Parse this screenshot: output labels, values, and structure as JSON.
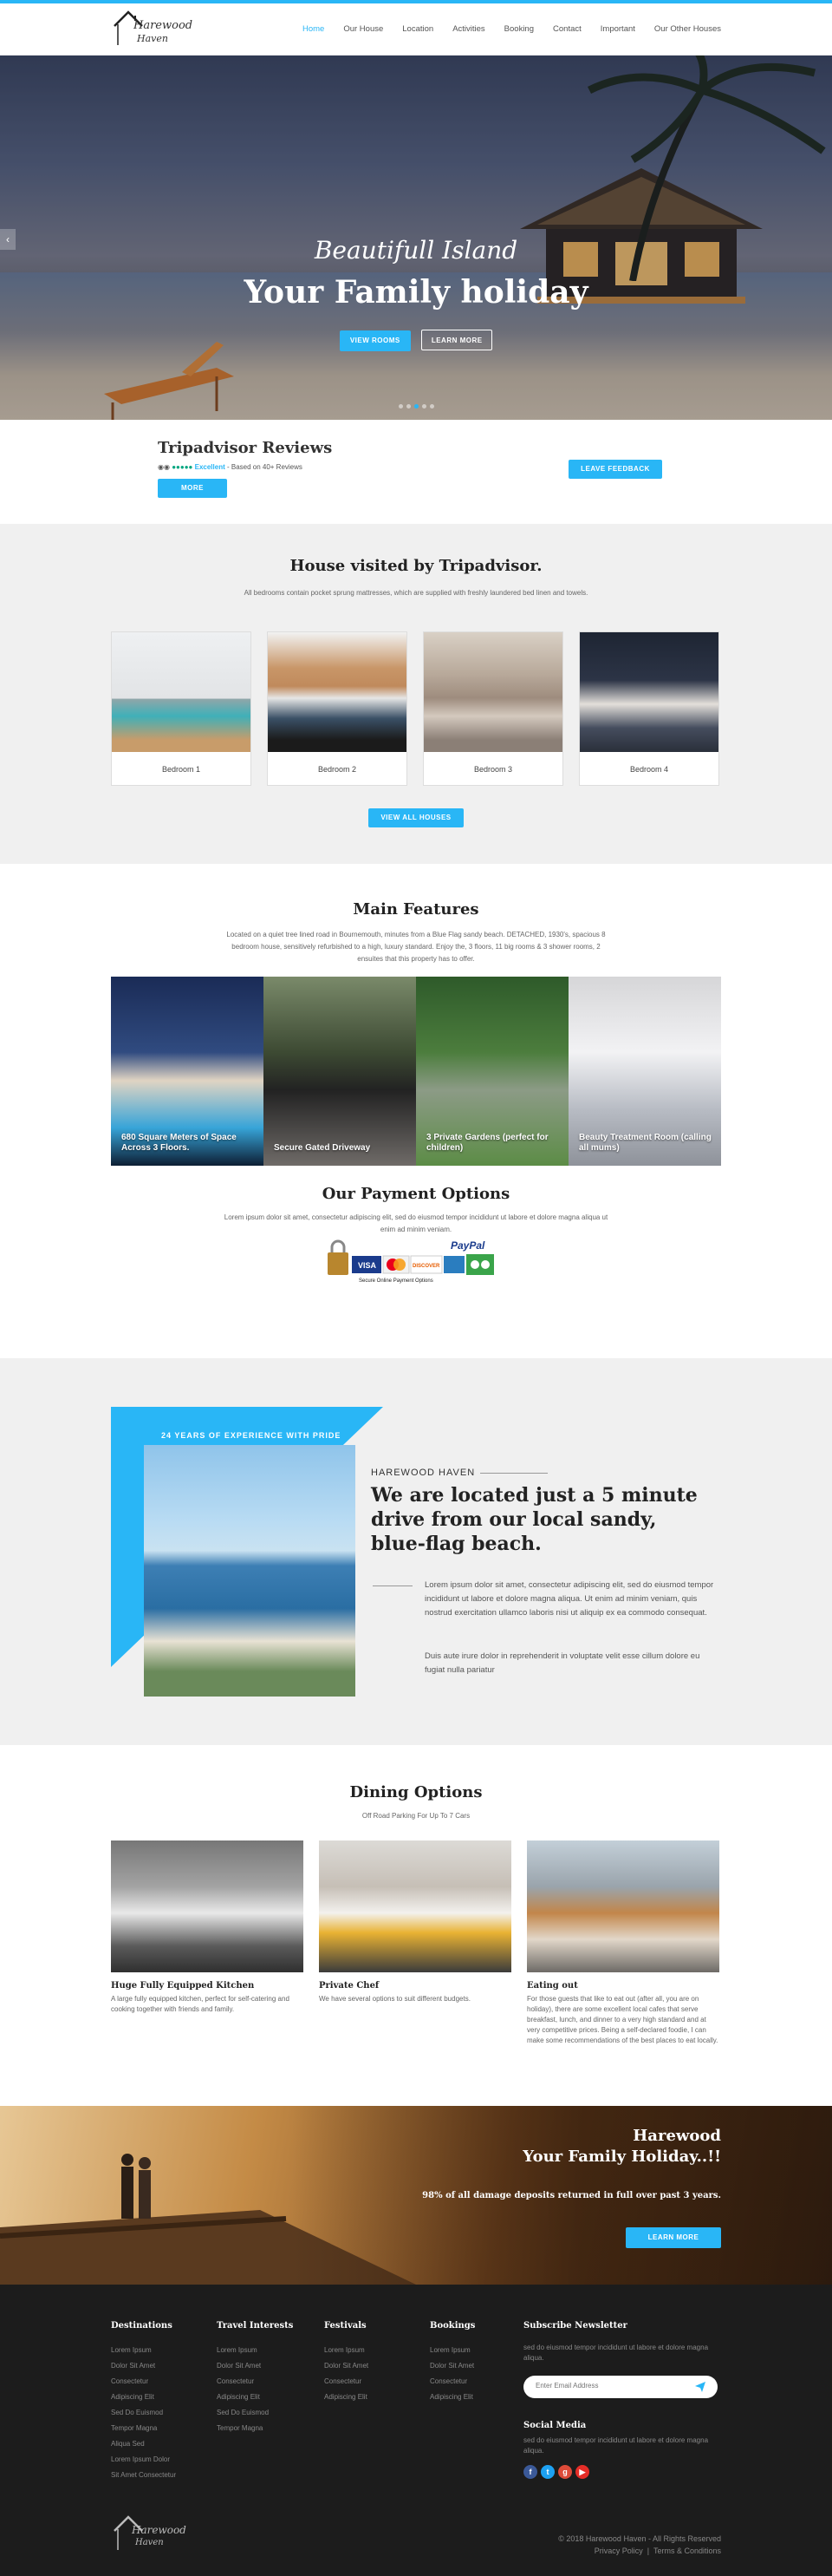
{
  "brand": {
    "logo_line1": "Harewood",
    "logo_line2": "Haven",
    "accent": "#29b6f6"
  },
  "nav": {
    "items": [
      "Home",
      "Our House",
      "Location",
      "Activities",
      "Booking",
      "Contact",
      "Important",
      "Our Other Houses"
    ],
    "active": "Home"
  },
  "hero": {
    "subtitle": "Beautifull Island",
    "title": "Your Family holiday",
    "btn_primary": "VIEW ROOMS",
    "btn_secondary": "LEARN MORE",
    "slide_count": 5,
    "active_slide": 3
  },
  "tripadvisor": {
    "title": "Tripadvisor Reviews",
    "rating_label": "Excellent",
    "rating_text": " - Based on 40+ Reviews",
    "more": "MORE",
    "feedback": "LEAVE FEEDBACK"
  },
  "rooms": {
    "title": "House visited by Tripadvisor.",
    "text": "All bedrooms contain pocket sprung mattresses, which are supplied with freshly laundered bed linen and towels.",
    "items": [
      "Bedroom 1",
      "Bedroom 2",
      "Bedroom 3",
      "Bedroom 4"
    ],
    "view_all": "VIEW ALL HOUSES"
  },
  "features": {
    "title": "Main Features",
    "text": "Located on a quiet tree lined road in Bournemouth, minutes from a Blue Flag sandy beach. DETACHED, 1930's, spacious 8 bedroom house, sensitively refurbished to a high, luxury standard. Enjoy the, 3 floors, 11 big rooms & 3 shower rooms, 2 ensuites that this property has to offer.",
    "items": [
      "680 Square Meters of Space Across 3 Floors.",
      "Secure Gated Driveway",
      "3 Private Gardens (perfect for children)",
      "Beauty Treatment Room (calling all mums)"
    ]
  },
  "payment": {
    "title": "Our Payment Options",
    "text": "Lorem ipsum dolor sit amet, consectetur adipiscing elit, sed do eiusmod tempor incididunt ut labore et dolore magna aliqua ut enim ad minim veniam.",
    "logo_paypal": "PayPal",
    "logo_visa": "VISA",
    "logo_discover": "DISCOVER",
    "logo_caption": "Secure Online Payment Options"
  },
  "location": {
    "badge": "24 YEARS OF EXPERIENCE WITH PRIDE",
    "eyebrow": "HAREWOOD HAVEN",
    "title": "We are located just a 5 minute drive from our local sandy, blue-flag beach.",
    "p1": "Lorem ipsum dolor sit amet, consectetur adipiscing elit, sed do eiusmod tempor incididunt ut labore et dolore magna aliqua. Ut enim ad minim veniam, quis nostrud exercitation ullamco laboris nisi ut aliquip ex ea commodo consequat.",
    "p2": "Duis aute irure dolor in reprehenderit in voluptate velit esse cillum dolore eu fugiat nulla pariatur"
  },
  "dining": {
    "title": "Dining Options",
    "subtitle": "Off Road Parking For Up To 7 Cars",
    "items": [
      {
        "title": "Huge Fully Equipped Kitchen",
        "text": "A large fully equipped kitchen, perfect for self-catering and cooking together with friends and family."
      },
      {
        "title": "Private Chef",
        "text": "We have several options to suit different budgets."
      },
      {
        "title": "Eating out",
        "text": "For those guests that like to eat out (after all, you are on holiday), there are some excellent local cafes that serve breakfast, lunch, and dinner to a very high standard and at very competitive prices. Being a self-declared foodie, I can make some recommendations of the best places to eat locally."
      }
    ]
  },
  "banner": {
    "line1": "Harewood",
    "line2": "Your Family Holiday..!!",
    "line3": "98% of all damage deposits returned in full over past 3 years.",
    "button": "LEARN MORE"
  },
  "footer": {
    "columns": [
      {
        "title": "Destinations",
        "items": [
          "Lorem Ipsum",
          "Dolor Sit Amet",
          "Consectetur",
          "Adipiscing Elit",
          "Sed Do Euismod",
          "Tempor Magna",
          "Aliqua Sed",
          "Lorem Ipsum Dolor",
          "Sit Amet Consectetur"
        ]
      },
      {
        "title": "Travel Interests",
        "items": [
          "Lorem Ipsum",
          "Dolor Sit Amet",
          "Consectetur",
          "Adipiscing Elit",
          "Sed Do Euismod",
          "Tempor Magna"
        ]
      },
      {
        "title": "Festivals",
        "items": [
          "Lorem Ipsum",
          "Dolor Sit Amet",
          "Consectetur",
          "Adipiscing Elit"
        ]
      },
      {
        "title": "Bookings",
        "items": [
          "Lorem Ipsum",
          "Dolor Sit Amet",
          "Consectetur",
          "Adipiscing Elit"
        ]
      }
    ],
    "subscribe_title": "Subscribe Newsletter",
    "subscribe_text": "sed do eiusmod tempor incididunt ut labore et dolore magna aliqua.",
    "email_placeholder": "Enter Email Address",
    "social_title": "Social Media",
    "social_text": "sed do eiusmod tempor incididunt ut labore et dolore magna aliqua.",
    "social_icons": [
      "facebook-icon",
      "twitter-icon",
      "google-plus-icon",
      "youtube-icon"
    ],
    "copyright": "© 2018 Harewood Haven - All Rights Reserved",
    "privacy": "Privacy Policy",
    "separator": "|",
    "terms": "Terms & Conditions"
  }
}
